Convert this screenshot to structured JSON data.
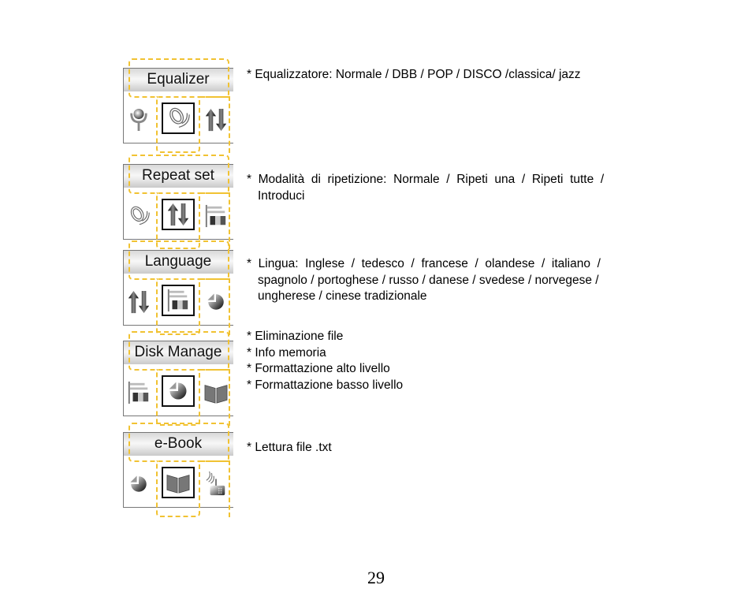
{
  "sections": [
    {
      "title": "Equalizer",
      "icons": [
        "microphone-icon",
        "equalizer-waves-icon",
        "repeat-arrows-icon"
      ],
      "description": [
        "* Equalizzatore: Normale / DBB / POP / DISCO /classica/ jazz"
      ]
    },
    {
      "title": "Repeat set",
      "icons": [
        "equalizer-waves-icon",
        "repeat-arrows-icon",
        "language-flag-icon"
      ],
      "description": [
        "*  Modalità  di  ripetizione:  Normale  /  Ripeti  una  /  Ripeti  tutte  /",
        "Introduci"
      ]
    },
    {
      "title": "Language",
      "icons": [
        "repeat-arrows-icon",
        "language-flag-icon",
        "disk-pie-icon"
      ],
      "description": [
        "*  Lingua:  Inglese  /  tedesco  /  francese  /  olandese  /  italiano  /",
        "spagnolo / portoghese / russo / danese / svedese / norvegese /",
        "ungherese / cinese tradizionale"
      ]
    },
    {
      "title": "Disk Manage",
      "icons": [
        "language-flag-icon",
        "disk-pie-icon",
        "ebook-icon"
      ],
      "description": [
        "* Eliminazione file",
        "* Info memoria",
        "* Formattazione alto livello",
        "* Formattazione basso livello"
      ]
    },
    {
      "title": "e-Book",
      "icons": [
        "disk-pie-icon",
        "ebook-icon",
        "radio-icon"
      ],
      "description": [
        "* Lettura file .txt"
      ]
    }
  ],
  "page_number": "29",
  "colors": {
    "dash": "#f1c232",
    "frame": "#777777"
  }
}
